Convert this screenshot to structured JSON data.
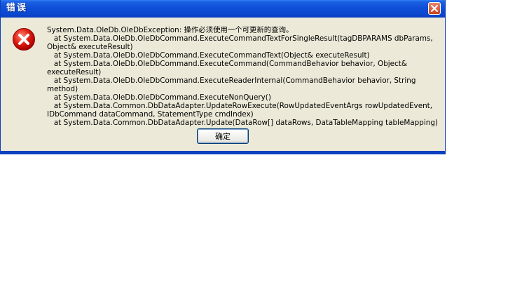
{
  "dialog": {
    "title": "错误",
    "message": "System.Data.OleDb.OleDbException: 操作必须使用一个可更新的查询。\n   at System.Data.OleDb.OleDbCommand.ExecuteCommandTextForSingleResult(tagDBPARAMS dbParams, Object& executeResult)\n   at System.Data.OleDb.OleDbCommand.ExecuteCommandText(Object& executeResult)\n   at System.Data.OleDb.OleDbCommand.ExecuteCommand(CommandBehavior behavior, Object& executeResult)\n   at System.Data.OleDb.OleDbCommand.ExecuteReaderInternal(CommandBehavior behavior, String method)\n   at System.Data.OleDb.OleDbCommand.ExecuteNonQuery()\n   at System.Data.Common.DbDataAdapter.UpdateRowExecute(RowUpdatedEventArgs rowUpdatedEvent, IDbCommand dataCommand, StatementType cmdIndex)\n   at System.Data.Common.DbDataAdapter.Update(DataRow[] dataRows, DataTableMapping tableMapping)",
    "ok_label": "确定",
    "icon": "error-icon",
    "colors": {
      "titlebar": "#0b47cf",
      "background": "#ece9d8",
      "close": "#c8431e",
      "error_icon": "#d40000"
    }
  }
}
